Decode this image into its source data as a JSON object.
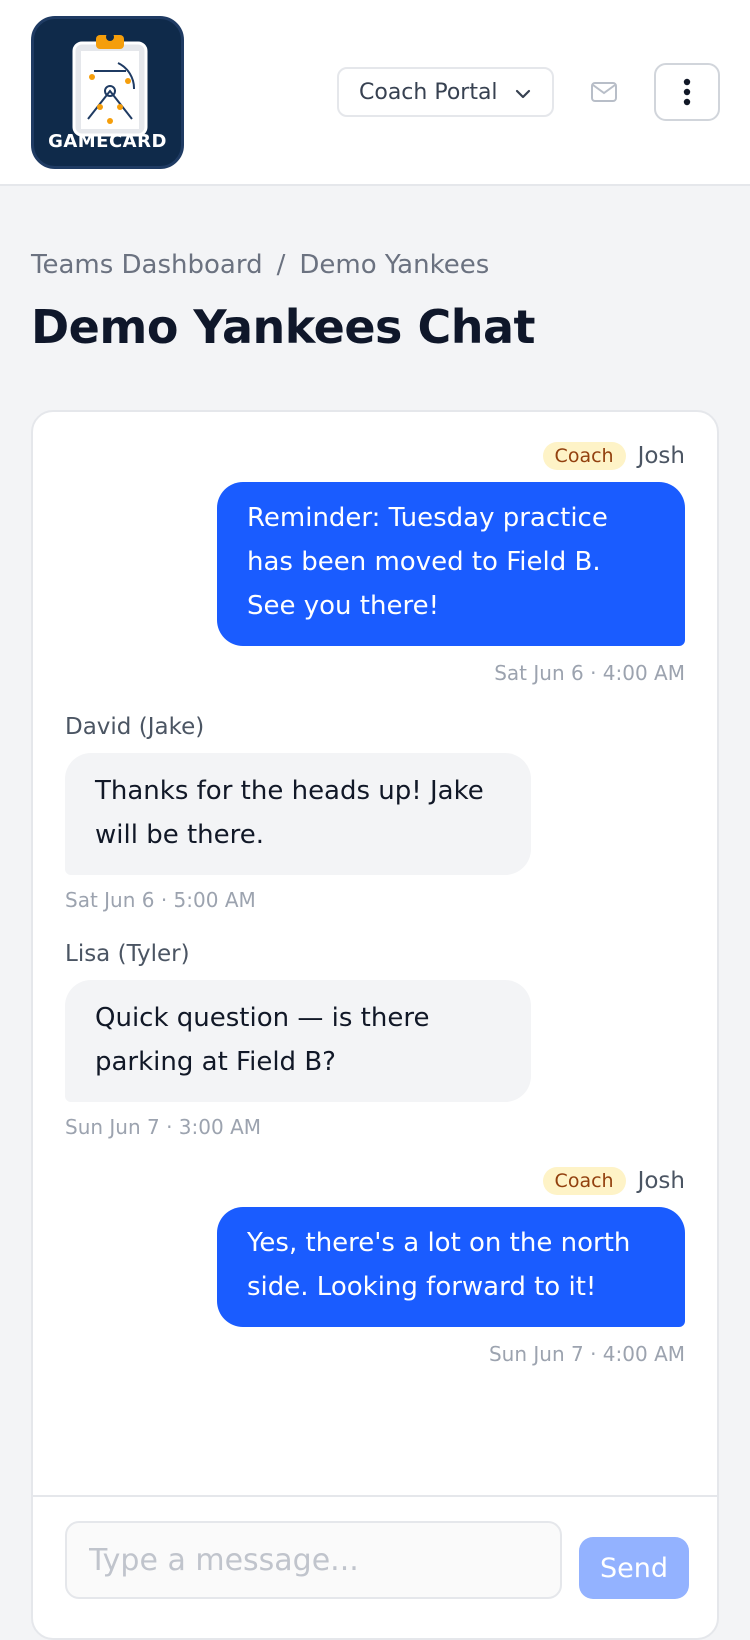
{
  "app": {
    "logo_text": "GAMECARD",
    "portal_label": "Coach Portal"
  },
  "breadcrumb": {
    "items": [
      "Teams Dashboard",
      "Demo Yankees"
    ],
    "separator": "/"
  },
  "page": {
    "title": "Demo Yankees Chat"
  },
  "messages": [
    {
      "direction": "outgoing",
      "role": "Coach",
      "sender": "Josh",
      "text": "Reminder: Tuesday practice has been moved to Field B. See you there!",
      "time": "Sat Jun 6 · 4:00 AM"
    },
    {
      "direction": "incoming",
      "sender": "David (Jake)",
      "text": "Thanks for the heads up! Jake will be there.",
      "time": "Sat Jun 6 · 5:00 AM"
    },
    {
      "direction": "incoming",
      "sender": "Lisa (Tyler)",
      "text": "Quick question — is there parking at Field B?",
      "time": "Sun Jun 7 · 3:00 AM"
    },
    {
      "direction": "outgoing",
      "role": "Coach",
      "sender": "Josh",
      "text": "Yes, there's a lot on the north side. Looking forward to it!",
      "time": "Sun Jun 7 · 4:00 AM"
    }
  ],
  "composer": {
    "placeholder": "Type a message...",
    "value": "",
    "send_label": "Send"
  },
  "icons": {
    "portal_dropdown": "chevron-down-icon",
    "mail": "mail-icon",
    "menu": "more-vertical-icon",
    "logo": "clipboard-field-icon"
  },
  "colors": {
    "accent": "#1a5cff",
    "send_disabled": "#93b2ff",
    "logo_bg": "#0f2a4a",
    "coach_badge_bg": "#fef3c7",
    "coach_badge_text": "#92400e"
  }
}
